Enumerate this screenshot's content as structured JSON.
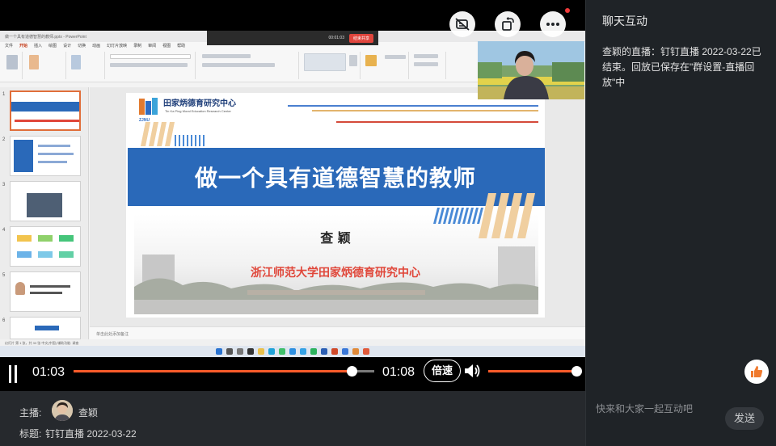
{
  "ppt": {
    "window_title": "做一个具有道德智慧的教师.pptx - PowerPoint",
    "meeting_time": "00:01:03",
    "meeting_end": "结束共享",
    "menu": [
      "文件",
      "开始",
      "插入",
      "绘图",
      "设计",
      "切换",
      "动画",
      "幻灯片放映",
      "录制",
      "审阅",
      "视图",
      "帮助"
    ],
    "notes_placeholder": "单击此处添加备注",
    "status": "幻灯片 第 1 张，共 33 张   中文(中国)   辅助功能: 调查"
  },
  "slide": {
    "org_cn": "田家炳德育研究中心",
    "org_en": "Tin Ka Ping Moral Education Research Center",
    "logo_text": "ZJNU",
    "title": "做一个具有道德智慧的教师",
    "presenter": "查 颖",
    "university": "浙江师范大学田家炳德育研究中心"
  },
  "player": {
    "current_time": "01:03",
    "duration": "01:08",
    "progress_fraction": 0.926,
    "speed_label": "倍速",
    "volume_fraction": 1.0
  },
  "info": {
    "host_label": "主播:",
    "host_name": "查颖",
    "title_label": "标题:",
    "title_value": "钉钉直播 2022-03-22"
  },
  "chat": {
    "title": "聊天互动",
    "message": "查颖的直播：钉钉直播 2022-03-22已结束。回放已保存在\"群设置-直播回放\"中",
    "input_placeholder": "快来和大家一起互动吧",
    "send_label": "发送"
  },
  "colors": {
    "accent_orange": "#ff5b2a",
    "slide_blue": "#2a69b9",
    "slide_red": "#e0473a"
  }
}
